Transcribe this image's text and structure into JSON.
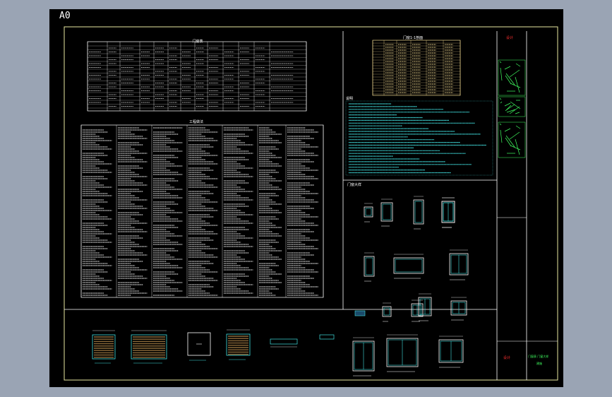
{
  "sheet": {
    "size_label": "A0"
  },
  "sections": {
    "door_window_table_title": "门窗表",
    "general_notes_title": "工程做法",
    "elevations_title": "门窗大样",
    "section_title": "门窗1-1剖面",
    "notes_title": "说明"
  },
  "title_block": {
    "stamp_label": "设计",
    "drawing_name": "门窗表 门窗大样",
    "sheet_no": "建施"
  },
  "colors": {
    "background": "#000000",
    "frame": "#e8e8a0",
    "linework": "#ffffff",
    "cyan": "#41e0e0",
    "yellow_table": "#f0d890",
    "red": "#ff3030",
    "green": "#40ff60",
    "hatch": "#8b6a3a"
  }
}
